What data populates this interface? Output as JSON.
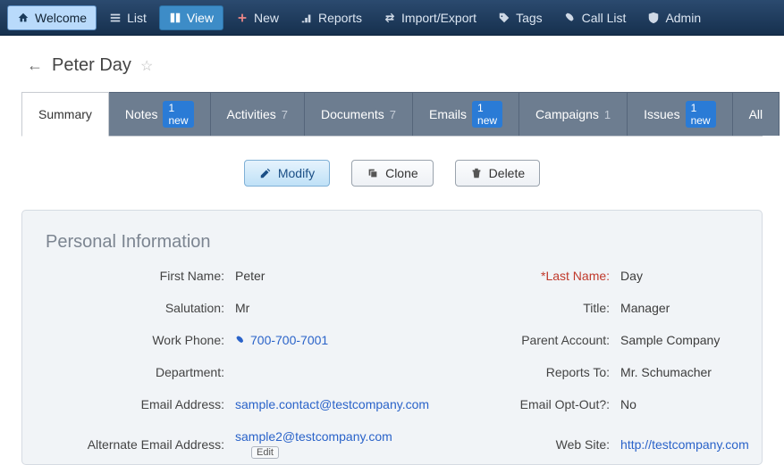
{
  "topnav": {
    "items": [
      {
        "label": "Welcome",
        "icon": "home",
        "state": "active-light"
      },
      {
        "label": "List",
        "icon": "list"
      },
      {
        "label": "View",
        "icon": "view",
        "state": "active-mid"
      },
      {
        "label": "New",
        "icon": "plus"
      },
      {
        "label": "Reports",
        "icon": "reports"
      },
      {
        "label": "Import/Export",
        "icon": "swap"
      },
      {
        "label": "Tags",
        "icon": "tag"
      },
      {
        "label": "Call List",
        "icon": "phone"
      },
      {
        "label": "Admin",
        "icon": "shield"
      }
    ]
  },
  "title": "Peter Day",
  "tabs": [
    {
      "label": "Summary"
    },
    {
      "label": "Notes",
      "badge_new": "1 new"
    },
    {
      "label": "Activities",
      "badge_num": "7"
    },
    {
      "label": "Documents",
      "badge_num": "7"
    },
    {
      "label": "Emails",
      "badge_new": "1 new"
    },
    {
      "label": "Campaigns",
      "badge_num": "1"
    },
    {
      "label": "Issues",
      "badge_new": "1 new"
    },
    {
      "label": "All"
    }
  ],
  "actions": {
    "modify": "Modify",
    "clone": "Clone",
    "delete": "Delete"
  },
  "section_title": "Personal Information",
  "fields": {
    "first_name": {
      "label": "First Name:",
      "value": "Peter"
    },
    "last_name": {
      "label": "*Last Name:",
      "value": "Day"
    },
    "salutation": {
      "label": "Salutation:",
      "value": "Mr"
    },
    "title": {
      "label": "Title:",
      "value": "Manager"
    },
    "work_phone": {
      "label": "Work Phone:",
      "value": "700-700-7001"
    },
    "parent_acct": {
      "label": "Parent Account:",
      "value": "Sample Company"
    },
    "department": {
      "label": "Department:",
      "value": ""
    },
    "reports_to": {
      "label": "Reports To:",
      "value": "Mr. Schumacher"
    },
    "email": {
      "label": "Email Address:",
      "value": "sample.contact@testcompany.com"
    },
    "opt_out": {
      "label": "Email Opt-Out?:",
      "value": "No"
    },
    "alt_email": {
      "label": "Alternate Email Address:",
      "value": "sample2@testcompany.com"
    },
    "web_site": {
      "label": "Web Site:",
      "value": "http://testcompany.com"
    }
  },
  "edit_label": "Edit"
}
